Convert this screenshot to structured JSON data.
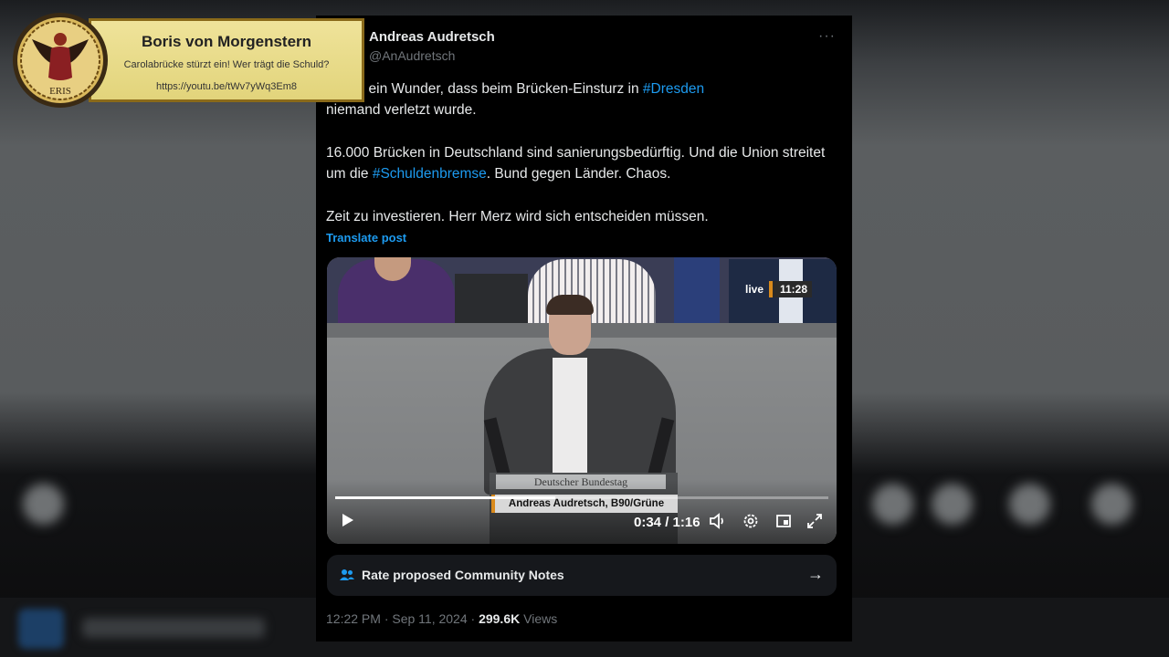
{
  "channel": {
    "name": "Boris von Morgenstern",
    "subtitle": "Carolabrücke stürzt ein! Wer trägt die Schuld?",
    "url": "https://youtu.be/tWv7yWq3Em8",
    "logo_text": "ERIS",
    "logo_icon": "eris-logo-icon"
  },
  "tweet": {
    "author_name": "Andreas Audretsch",
    "author_handle": "@AnAudretsch",
    "more_label": "···",
    "line1_pre": "nzt an ein Wunder, dass beim Brücken-Einsturz in ",
    "line1_tag": "#Dresden",
    "line1_post": "niemand verletzt wurde.",
    "para2_pre": "16.000 Brücken in Deutschland sind sanierungsbedürftig. Und die Union streitet um die ",
    "para2_tag": "#Schuldenbremse",
    "para2_post": ". Bund gegen Länder. Chaos.",
    "para3": "Zeit zu investieren. Herr Merz wird sich entscheiden müssen.",
    "translate_label": "Translate post",
    "timestamp": "12:22 PM · Sep 11, 2024 · ",
    "views_count": "299.6K",
    "views_label": "Views"
  },
  "video": {
    "live_label": "live",
    "clock": "11:28",
    "podium_sign": "Deutscher Bundestag",
    "lower_third": "Andreas Audretsch, B90/Grüne",
    "current_time": "0:34",
    "duration": "1:16",
    "time_display": "0:34 / 1:16",
    "progress_fraction": 0.447,
    "icons": [
      "play-icon",
      "volume-icon",
      "settings-icon",
      "pip-icon",
      "fullscreen-icon"
    ]
  },
  "community_notes": {
    "label": "Rate proposed Community Notes",
    "icon": "people-icon",
    "arrow": "→"
  },
  "colors": {
    "accent": "#1d9bf0",
    "text": "#e7e9ea",
    "muted": "#71767b",
    "badge_bg": "#e8dc8a",
    "badge_border": "#8a6a1a"
  }
}
